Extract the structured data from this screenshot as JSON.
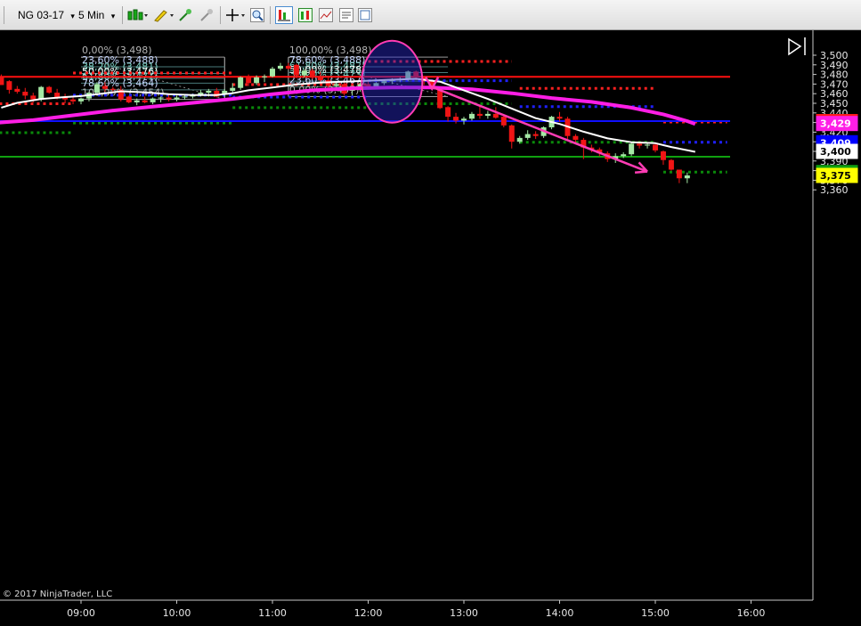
{
  "toolbar": {
    "instrument": "NG 03-17",
    "interval": "5 Min",
    "dropdown_arrow": "▾"
  },
  "copyright": "© 2017 NinjaTrader, LLC",
  "colors": {
    "bull": "#a5e8a5",
    "bear": "#f01515",
    "ema_fast": "#ffffff",
    "ema_slow": "#ff1ee6",
    "fib": "#b8b8b8",
    "resistance": "#ff2020",
    "support": "#0a8a0a",
    "pivot": "#2020ff",
    "annotation": "#ff3cb4"
  },
  "chart_data": {
    "type": "candlestick",
    "instrument": "NG 03-17",
    "interval": "5 Min",
    "x_tick_labels": [
      "09:00",
      "10:00",
      "11:00",
      "12:00",
      "13:00",
      "14:00",
      "15:00",
      "16:00"
    ],
    "y_tick_labels": [
      "3,500",
      "3,490",
      "3,480",
      "3,470",
      "3,460",
      "3,450",
      "3,440",
      "3,430",
      "3,420",
      "3,410",
      "3,400",
      "3,390",
      "3,380",
      "3,370",
      "3,360"
    ],
    "ylim": [
      3.359,
      3.504
    ],
    "xlim": [
      "08:05",
      "16:15"
    ],
    "candles": [
      {
        "t": "08:10",
        "o": 3.478,
        "h": 3.48,
        "l": 3.474,
        "c": 3.469
      },
      {
        "t": "08:15",
        "o": 3.473,
        "h": 3.474,
        "l": 3.46,
        "c": 3.464
      },
      {
        "t": "08:20",
        "o": 3.465,
        "h": 3.468,
        "l": 3.46,
        "c": 3.462
      },
      {
        "t": "08:25",
        "o": 3.462,
        "h": 3.466,
        "l": 3.454,
        "c": 3.458
      },
      {
        "t": "08:30",
        "o": 3.458,
        "h": 3.461,
        "l": 3.451,
        "c": 3.454
      },
      {
        "t": "08:35",
        "o": 3.454,
        "h": 3.468,
        "l": 3.452,
        "c": 3.467
      },
      {
        "t": "08:40",
        "o": 3.467,
        "h": 3.468,
        "l": 3.46,
        "c": 3.461
      },
      {
        "t": "08:45",
        "o": 3.461,
        "h": 3.465,
        "l": 3.454,
        "c": 3.456
      },
      {
        "t": "08:50",
        "o": 3.456,
        "h": 3.46,
        "l": 3.45,
        "c": 3.454
      },
      {
        "t": "08:55",
        "o": 3.454,
        "h": 3.457,
        "l": 3.449,
        "c": 3.452
      },
      {
        "t": "09:00",
        "o": 3.452,
        "h": 3.456,
        "l": 3.449,
        "c": 3.455
      },
      {
        "t": "09:05",
        "o": 3.455,
        "h": 3.462,
        "l": 3.452,
        "c": 3.461
      },
      {
        "t": "09:10",
        "o": 3.461,
        "h": 3.472,
        "l": 3.459,
        "c": 3.47
      },
      {
        "t": "09:15",
        "o": 3.468,
        "h": 3.472,
        "l": 3.462,
        "c": 3.465
      },
      {
        "t": "09:20",
        "o": 3.465,
        "h": 3.467,
        "l": 3.462,
        "c": 3.464
      },
      {
        "t": "09:25",
        "o": 3.464,
        "h": 3.468,
        "l": 3.452,
        "c": 3.454
      },
      {
        "t": "09:30",
        "o": 3.457,
        "h": 3.458,
        "l": 3.45,
        "c": 3.451
      },
      {
        "t": "09:35",
        "o": 3.451,
        "h": 3.455,
        "l": 3.448,
        "c": 3.453
      },
      {
        "t": "09:40",
        "o": 3.453,
        "h": 3.457,
        "l": 3.45,
        "c": 3.451
      },
      {
        "t": "09:45",
        "o": 3.451,
        "h": 3.456,
        "l": 3.449,
        "c": 3.455
      },
      {
        "t": "09:50",
        "o": 3.455,
        "h": 3.457,
        "l": 3.451,
        "c": 3.456
      },
      {
        "t": "09:55",
        "o": 3.456,
        "h": 3.459,
        "l": 3.452,
        "c": 3.454
      },
      {
        "t": "10:00",
        "o": 3.454,
        "h": 3.458,
        "l": 3.452,
        "c": 3.456
      },
      {
        "t": "10:05",
        "o": 3.456,
        "h": 3.458,
        "l": 3.454,
        "c": 3.457
      },
      {
        "t": "10:10",
        "o": 3.457,
        "h": 3.46,
        "l": 3.455,
        "c": 3.459
      },
      {
        "t": "10:15",
        "o": 3.459,
        "h": 3.464,
        "l": 3.457,
        "c": 3.461
      },
      {
        "t": "10:20",
        "o": 3.461,
        "h": 3.465,
        "l": 3.457,
        "c": 3.463
      },
      {
        "t": "10:25",
        "o": 3.463,
        "h": 3.466,
        "l": 3.456,
        "c": 3.457
      },
      {
        "t": "10:30",
        "o": 3.46,
        "h": 3.465,
        "l": 3.456,
        "c": 3.463
      },
      {
        "t": "10:35",
        "o": 3.463,
        "h": 3.471,
        "l": 3.46,
        "c": 3.466
      },
      {
        "t": "10:40",
        "o": 3.466,
        "h": 3.478,
        "l": 3.464,
        "c": 3.477
      },
      {
        "t": "10:45",
        "o": 3.477,
        "h": 3.48,
        "l": 3.468,
        "c": 3.471
      },
      {
        "t": "10:50",
        "o": 3.471,
        "h": 3.479,
        "l": 3.469,
        "c": 3.477
      },
      {
        "t": "10:55",
        "o": 3.477,
        "h": 3.48,
        "l": 3.472,
        "c": 3.478
      },
      {
        "t": "11:00",
        "o": 3.478,
        "h": 3.488,
        "l": 3.477,
        "c": 3.486
      },
      {
        "t": "11:05",
        "o": 3.486,
        "h": 3.492,
        "l": 3.484,
        "c": 3.489
      },
      {
        "t": "11:10",
        "o": 3.489,
        "h": 3.492,
        "l": 3.485,
        "c": 3.486
      },
      {
        "t": "11:15",
        "o": 3.49,
        "h": 3.491,
        "l": 3.476,
        "c": 3.479
      },
      {
        "t": "11:20",
        "o": 3.479,
        "h": 3.486,
        "l": 3.477,
        "c": 3.484
      },
      {
        "t": "11:25",
        "o": 3.484,
        "h": 3.486,
        "l": 3.475,
        "c": 3.477
      },
      {
        "t": "11:30",
        "o": 3.477,
        "h": 3.483,
        "l": 3.472,
        "c": 3.474
      },
      {
        "t": "11:35",
        "o": 3.474,
        "h": 3.478,
        "l": 3.465,
        "c": 3.468
      },
      {
        "t": "11:40",
        "o": 3.468,
        "h": 3.472,
        "l": 3.464,
        "c": 3.47
      },
      {
        "t": "11:45",
        "o": 3.47,
        "h": 3.472,
        "l": 3.458,
        "c": 3.46
      },
      {
        "t": "11:50",
        "o": 3.463,
        "h": 3.467,
        "l": 3.458,
        "c": 3.466
      },
      {
        "t": "11:55",
        "o": 3.466,
        "h": 3.472,
        "l": 3.462,
        "c": 3.47
      },
      {
        "t": "12:00",
        "o": 3.47,
        "h": 3.473,
        "l": 3.465,
        "c": 3.467
      },
      {
        "t": "12:05",
        "o": 3.467,
        "h": 3.472,
        "l": 3.466,
        "c": 3.471
      },
      {
        "t": "12:10",
        "o": 3.471,
        "h": 3.474,
        "l": 3.469,
        "c": 3.473
      },
      {
        "t": "12:15",
        "o": 3.473,
        "h": 3.476,
        "l": 3.47,
        "c": 3.474
      },
      {
        "t": "12:20",
        "o": 3.474,
        "h": 3.477,
        "l": 3.472,
        "c": 3.475
      },
      {
        "t": "12:25",
        "o": 3.475,
        "h": 3.484,
        "l": 3.473,
        "c": 3.483
      },
      {
        "t": "12:30",
        "o": 3.483,
        "h": 3.484,
        "l": 3.474,
        "c": 3.477
      },
      {
        "t": "12:35",
        "o": 3.477,
        "h": 3.478,
        "l": 3.469,
        "c": 3.473
      },
      {
        "t": "12:40",
        "o": 3.473,
        "h": 3.474,
        "l": 3.466,
        "c": 3.467
      },
      {
        "t": "12:45",
        "o": 3.467,
        "h": 3.467,
        "l": 3.444,
        "c": 3.445
      },
      {
        "t": "12:50",
        "o": 3.446,
        "h": 3.447,
        "l": 3.431,
        "c": 3.436
      },
      {
        "t": "12:55",
        "o": 3.436,
        "h": 3.44,
        "l": 3.429,
        "c": 3.432
      },
      {
        "t": "13:00",
        "o": 3.432,
        "h": 3.436,
        "l": 3.428,
        "c": 3.434
      },
      {
        "t": "13:05",
        "o": 3.434,
        "h": 3.441,
        "l": 3.432,
        "c": 3.439
      },
      {
        "t": "13:10",
        "o": 3.439,
        "h": 3.447,
        "l": 3.434,
        "c": 3.437
      },
      {
        "t": "13:15",
        "o": 3.437,
        "h": 3.442,
        "l": 3.434,
        "c": 3.439
      },
      {
        "t": "13:20",
        "o": 3.439,
        "h": 3.446,
        "l": 3.434,
        "c": 3.435
      },
      {
        "t": "13:25",
        "o": 3.436,
        "h": 3.438,
        "l": 3.425,
        "c": 3.427
      },
      {
        "t": "13:30",
        "o": 3.427,
        "h": 3.428,
        "l": 3.403,
        "c": 3.41
      },
      {
        "t": "13:35",
        "o": 3.41,
        "h": 3.416,
        "l": 3.408,
        "c": 3.414
      },
      {
        "t": "13:40",
        "o": 3.414,
        "h": 3.422,
        "l": 3.412,
        "c": 3.418
      },
      {
        "t": "13:45",
        "o": 3.418,
        "h": 3.421,
        "l": 3.413,
        "c": 3.416
      },
      {
        "t": "13:50",
        "o": 3.416,
        "h": 3.426,
        "l": 3.414,
        "c": 3.425
      },
      {
        "t": "13:55",
        "o": 3.425,
        "h": 3.437,
        "l": 3.423,
        "c": 3.436
      },
      {
        "t": "14:00",
        "o": 3.436,
        "h": 3.441,
        "l": 3.431,
        "c": 3.434
      },
      {
        "t": "14:05",
        "o": 3.434,
        "h": 3.436,
        "l": 3.413,
        "c": 3.416
      },
      {
        "t": "14:10",
        "o": 3.416,
        "h": 3.418,
        "l": 3.409,
        "c": 3.412
      },
      {
        "t": "14:15",
        "o": 3.412,
        "h": 3.414,
        "l": 3.392,
        "c": 3.404
      },
      {
        "t": "14:20",
        "o": 3.404,
        "h": 3.407,
        "l": 3.399,
        "c": 3.402
      },
      {
        "t": "14:25",
        "o": 3.402,
        "h": 3.404,
        "l": 3.395,
        "c": 3.398
      },
      {
        "t": "14:30",
        "o": 3.398,
        "h": 3.4,
        "l": 3.389,
        "c": 3.392
      },
      {
        "t": "14:35",
        "o": 3.392,
        "h": 3.398,
        "l": 3.388,
        "c": 3.395
      },
      {
        "t": "14:40",
        "o": 3.395,
        "h": 3.399,
        "l": 3.393,
        "c": 3.397
      },
      {
        "t": "14:45",
        "o": 3.397,
        "h": 3.409,
        "l": 3.395,
        "c": 3.408
      },
      {
        "t": "14:50",
        "o": 3.408,
        "h": 3.41,
        "l": 3.403,
        "c": 3.406
      },
      {
        "t": "14:55",
        "o": 3.406,
        "h": 3.409,
        "l": 3.403,
        "c": 3.407
      },
      {
        "t": "15:00",
        "o": 3.407,
        "h": 3.409,
        "l": 3.399,
        "c": 3.401
      },
      {
        "t": "15:05",
        "o": 3.4,
        "h": 3.401,
        "l": 3.386,
        "c": 3.391
      },
      {
        "t": "15:10",
        "o": 3.391,
        "h": 3.392,
        "l": 3.38,
        "c": 3.381
      },
      {
        "t": "15:15",
        "o": 3.381,
        "h": 3.381,
        "l": 3.367,
        "c": 3.372
      },
      {
        "t": "15:20",
        "o": 3.372,
        "h": 3.378,
        "l": 3.367,
        "c": 3.375
      }
    ],
    "fib_retracements": [
      {
        "from_time": "09:00",
        "to_time": "10:30",
        "levels": [
          {
            "label": "0,00% (3,498)",
            "value": 3.498
          },
          {
            "label": "23,60% (3,488)",
            "value": 3.488
          },
          {
            "label": "38,20% (3,481)",
            "value": 3.481
          },
          {
            "label": "50,00% (3,476)",
            "value": 3.476
          },
          {
            "label": "61,80% (3,471)",
            "value": 3.471
          },
          {
            "label": "78,60% (3,464)",
            "value": 3.464
          },
          {
            "label": "100,00% (3,454)",
            "value": 3.454
          }
        ]
      },
      {
        "from_time": "11:10",
        "to_time": "12:50",
        "levels": [
          {
            "label": "100,00% (3,498)",
            "value": 3.498
          },
          {
            "label": "78,60% (3,488)",
            "value": 3.488
          },
          {
            "label": "61,80% (3,482)",
            "value": 3.482
          },
          {
            "label": "50,00% (3,478)",
            "value": 3.478
          },
          {
            "label": "38,20% (3,473)",
            "value": 3.473
          },
          {
            "label": "23,60% (3,467)",
            "value": 3.467
          },
          {
            "label": "0,00% (3,457)",
            "value": 3.457
          }
        ]
      }
    ],
    "horizontal_lines": [
      {
        "value": 3.4775,
        "color": "red"
      },
      {
        "value": 3.4315,
        "color": "blue"
      },
      {
        "value": 3.3945,
        "color": "green"
      }
    ],
    "dotted_levels": [
      {
        "from_time": "08:05",
        "to_time": "08:55",
        "value": 3.4495,
        "color": "red"
      },
      {
        "from_time": "08:05",
        "to_time": "08:55",
        "value": 3.4195,
        "color": "green"
      },
      {
        "from_time": "08:55",
        "to_time": "10:35",
        "value": 3.4815,
        "color": "red"
      },
      {
        "from_time": "08:55",
        "to_time": "10:35",
        "value": 3.4585,
        "color": "blue"
      },
      {
        "from_time": "08:55",
        "to_time": "10:35",
        "value": 3.4295,
        "color": "green"
      },
      {
        "from_time": "10:35",
        "to_time": "12:00",
        "value": 3.4695,
        "color": "red"
      },
      {
        "from_time": "10:35",
        "to_time": "12:00",
        "value": 3.4565,
        "color": "blue"
      },
      {
        "from_time": "10:35",
        "to_time": "12:00",
        "value": 3.4455,
        "color": "green"
      },
      {
        "from_time": "12:00",
        "to_time": "13:30",
        "value": 3.4935,
        "color": "red"
      },
      {
        "from_time": "12:00",
        "to_time": "13:30",
        "value": 3.4735,
        "color": "blue"
      },
      {
        "from_time": "12:00",
        "to_time": "13:30",
        "value": 3.4495,
        "color": "green"
      },
      {
        "from_time": "13:35",
        "to_time": "15:00",
        "value": 3.4655,
        "color": "red"
      },
      {
        "from_time": "13:35",
        "to_time": "15:00",
        "value": 3.4465,
        "color": "blue"
      },
      {
        "from_time": "13:35",
        "to_time": "15:00",
        "value": 3.4095,
        "color": "green"
      },
      {
        "from_time": "15:05",
        "to_time": "15:45",
        "value": 3.4305,
        "color": "red"
      },
      {
        "from_time": "15:05",
        "to_time": "15:45",
        "value": 3.4095,
        "color": "blue"
      },
      {
        "from_time": "15:05",
        "to_time": "15:45",
        "value": 3.3785,
        "color": "green"
      }
    ],
    "ema_fast": [
      {
        "t": "08:10",
        "v": 3.4455
      },
      {
        "t": "08:20",
        "v": 3.4505
      },
      {
        "t": "08:35",
        "v": 3.4545
      },
      {
        "t": "08:50",
        "v": 3.4565
      },
      {
        "t": "09:00",
        "v": 3.4575
      },
      {
        "t": "09:15",
        "v": 3.4605
      },
      {
        "t": "09:25",
        "v": 3.4625
      },
      {
        "t": "09:40",
        "v": 3.4615
      },
      {
        "t": "09:55",
        "v": 3.4595
      },
      {
        "t": "10:10",
        "v": 3.4585
      },
      {
        "t": "10:25",
        "v": 3.4585
      },
      {
        "t": "10:35",
        "v": 3.4605
      },
      {
        "t": "10:45",
        "v": 3.4635
      },
      {
        "t": "11:00",
        "v": 3.4665
      },
      {
        "t": "11:15",
        "v": 3.4695
      },
      {
        "t": "11:30",
        "v": 3.4715
      },
      {
        "t": "11:45",
        "v": 3.4725
      },
      {
        "t": "12:00",
        "v": 3.4735
      },
      {
        "t": "12:15",
        "v": 3.4745
      },
      {
        "t": "12:30",
        "v": 3.4755
      },
      {
        "t": "12:45",
        "v": 3.4725
      },
      {
        "t": "13:00",
        "v": 3.4635
      },
      {
        "t": "13:15",
        "v": 3.4545
      },
      {
        "t": "13:30",
        "v": 3.4445
      },
      {
        "t": "13:45",
        "v": 3.4345
      },
      {
        "t": "14:00",
        "v": 3.4285
      },
      {
        "t": "14:15",
        "v": 3.4205
      },
      {
        "t": "14:30",
        "v": 3.4135
      },
      {
        "t": "14:45",
        "v": 3.4095
      },
      {
        "t": "15:00",
        "v": 3.4085
      },
      {
        "t": "15:10",
        "v": 3.4045
      },
      {
        "t": "15:25",
        "v": 3.3995
      }
    ],
    "ema_slow": [
      {
        "t": "08:05",
        "v": 3.4295
      },
      {
        "t": "08:30",
        "v": 3.4325
      },
      {
        "t": "08:55",
        "v": 3.4375
      },
      {
        "t": "09:20",
        "v": 3.4425
      },
      {
        "t": "09:45",
        "v": 3.4465
      },
      {
        "t": "10:10",
        "v": 3.4505
      },
      {
        "t": "10:35",
        "v": 3.4545
      },
      {
        "t": "11:00",
        "v": 3.4595
      },
      {
        "t": "11:25",
        "v": 3.4635
      },
      {
        "t": "11:50",
        "v": 3.4655
      },
      {
        "t": "12:15",
        "v": 3.4665
      },
      {
        "t": "12:40",
        "v": 3.4665
      },
      {
        "t": "13:05",
        "v": 3.4645
      },
      {
        "t": "13:30",
        "v": 3.4605
      },
      {
        "t": "13:55",
        "v": 3.4555
      },
      {
        "t": "14:20",
        "v": 3.4515
      },
      {
        "t": "14:45",
        "v": 3.4455
      },
      {
        "t": "15:05",
        "v": 3.4385
      },
      {
        "t": "15:20",
        "v": 3.4315
      },
      {
        "t": "15:25",
        "v": 3.4285
      }
    ],
    "price_markers": [
      {
        "value": 3.431,
        "label": "3,431",
        "bg": "#ff1a1a",
        "fg": "#ffffff",
        "border": "#ff1a1a"
      },
      {
        "value": 3.429,
        "label": "3,429",
        "bg": "#ff1ee6",
        "fg": "#ffffff",
        "border": "#ff1ee6"
      },
      {
        "value": 3.409,
        "label": "3,409",
        "bg": "#0000ff",
        "fg": "#ffffff",
        "border": "#0000ff"
      },
      {
        "value": 3.4,
        "label": "3,400",
        "bg": "#ffffff",
        "fg": "#000000",
        "border": "#ffffff"
      },
      {
        "value": 3.378,
        "label": "3,378",
        "bg": "#10a010",
        "fg": "#ffffff",
        "border": "#10a010"
      },
      {
        "value": 3.375,
        "label": "3,375",
        "bg": "#ffff00",
        "fg": "#000000",
        "border": "#ffff00"
      }
    ],
    "annotations": {
      "ellipse": {
        "center_time": "12:15",
        "center_value": 3.4725,
        "label": ""
      },
      "arrow": {
        "from_time": "12:40",
        "from_value": 3.467,
        "to_time": "14:55",
        "to_value": 3.379
      }
    }
  }
}
